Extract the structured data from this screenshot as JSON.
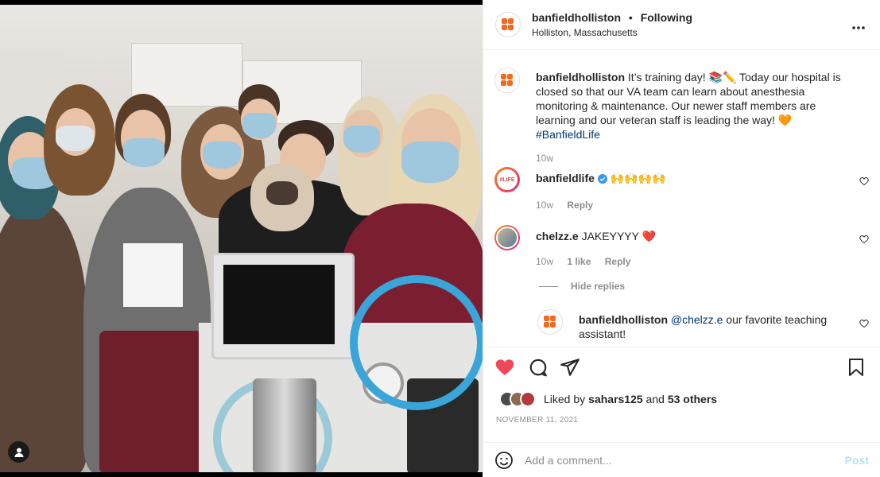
{
  "header": {
    "username": "banfieldholliston",
    "separator": "•",
    "follow_label": "Following",
    "location": "Holliston, Massachusetts",
    "more_icon": "more-horizontal-icon"
  },
  "caption": {
    "username": "banfieldholliston",
    "text_part1": "It’s training day! 📚✏️ Today our hospital is closed so that our VA team can learn about anesthesia monitoring & maintenance. Our newer staff members are learning and our veteran staff is leading the way! 🧡 ",
    "hashtag": "#BanfieldLife",
    "time": "10w"
  },
  "comments": [
    {
      "username": "banfieldlife",
      "verified_icon": "verified-badge-icon",
      "text": " 🙌🙌🙌🙌",
      "avatar_text": "#LIFE",
      "time": "10w",
      "reply_label": "Reply"
    },
    {
      "username": "chelzz.e",
      "text": " JAKEYYYY ❤️",
      "time": "10w",
      "likes": "1 like",
      "reply_label": "Reply"
    }
  ],
  "hide_replies_label": "Hide replies",
  "reply": {
    "username": "banfieldholliston",
    "mention": "@chelzz.e",
    "text": " our favorite teaching assistant!"
  },
  "likes": {
    "prefix": "Liked by ",
    "user": "sahars125",
    "middle": " and ",
    "others": "53 others"
  },
  "date": "NOVEMBER 11, 2021",
  "add_comment": {
    "placeholder": "Add a comment...",
    "post_label": "Post"
  },
  "colors": {
    "like_red": "#ed4956",
    "link_blue": "#00376b",
    "post_disabled": "#b2dffc",
    "brand_orange": "#f26a21"
  }
}
